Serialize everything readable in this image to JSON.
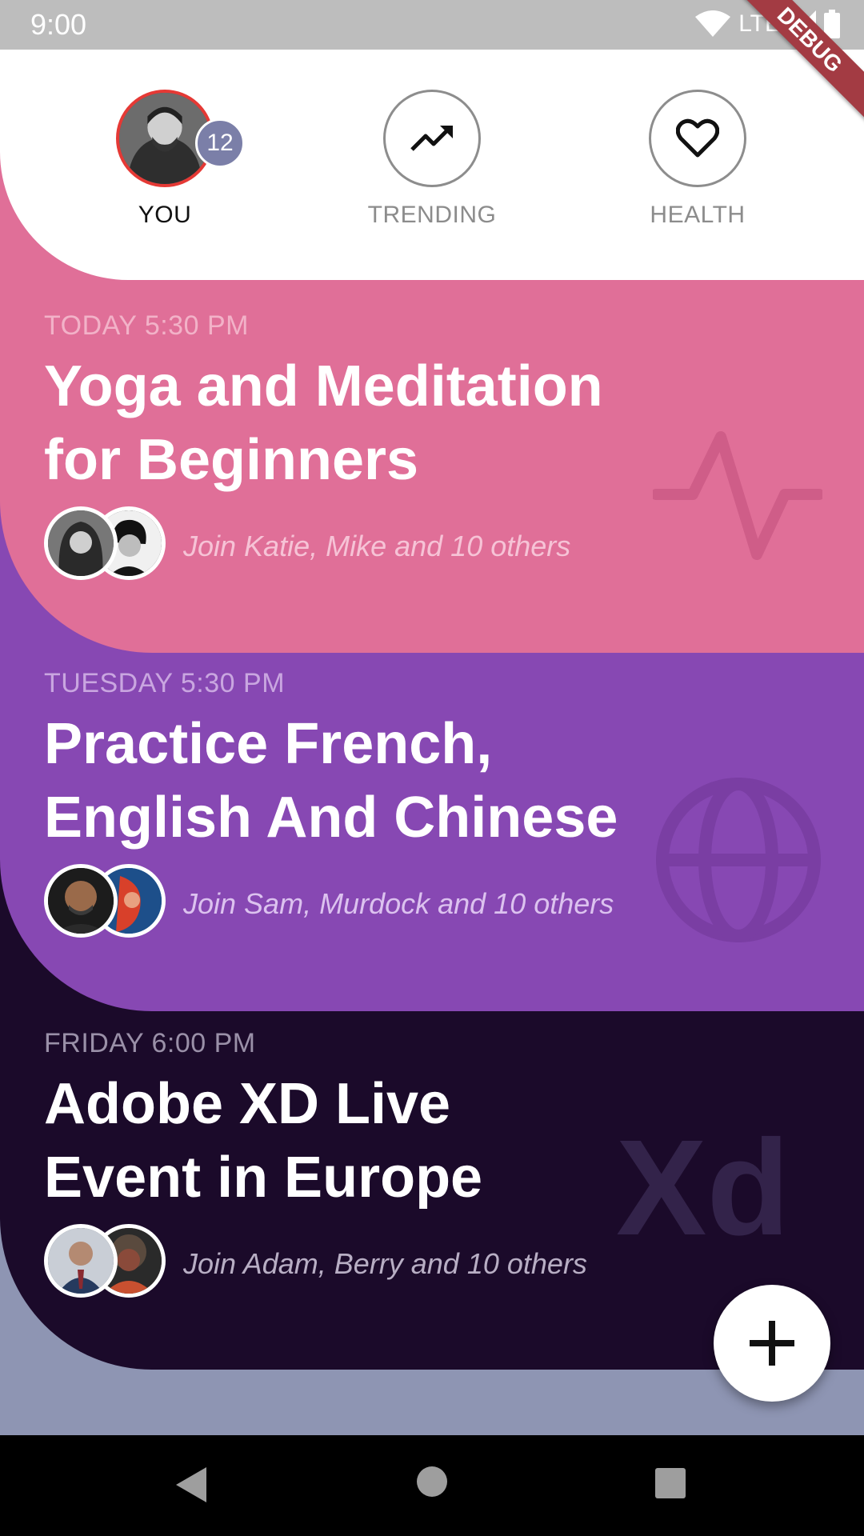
{
  "status_bar": {
    "time": "9:00",
    "network": "LTE"
  },
  "debug_banner": "DEBUG",
  "header": {
    "tabs": [
      {
        "label": "YOU",
        "badge": "12",
        "active": true
      },
      {
        "label": "TRENDING",
        "icon": "trending-up-icon"
      },
      {
        "label": "HEALTH",
        "icon": "heart-icon"
      }
    ]
  },
  "events": [
    {
      "date": "TODAY 5:30 PM",
      "title_line1": "Yoga and Meditation",
      "title_line2": "for Beginners",
      "join": "Join Katie, Mike and 10 others",
      "background_icon": "activity-pulse-icon",
      "color": "#e06f98"
    },
    {
      "date": "TUESDAY 5:30 PM",
      "title_line1": "Practice French,",
      "title_line2": "English And Chinese",
      "join": "Join Sam, Murdock and 10 others",
      "background_icon": "globe-icon",
      "color": "#8748b3"
    },
    {
      "date": "FRIDAY 6:00 PM",
      "title_line1": "Adobe XD Live",
      "title_line2": "Event in Europe",
      "join": "Join Adam, Berry and 10 others",
      "background_icon": "xd-logo-icon",
      "background_text": "Xd",
      "color": "#1b0a2a"
    }
  ],
  "fab": {
    "icon": "plus-icon"
  },
  "navigation_bar": {
    "buttons": [
      "back-icon",
      "home-icon",
      "recents-icon"
    ]
  }
}
